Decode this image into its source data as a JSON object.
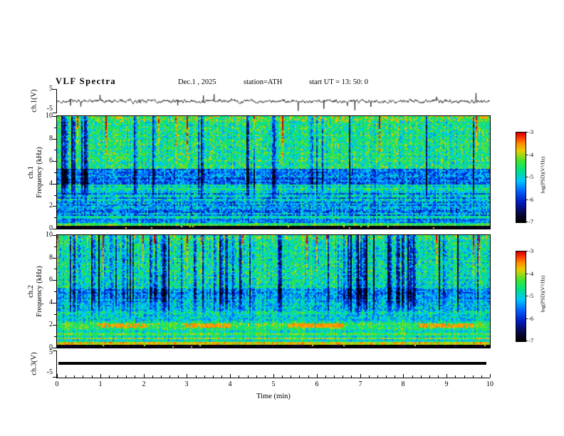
{
  "header": {
    "title": "VLF  Spectra",
    "date": "Dec.1  , 2025",
    "station": "station=ATH",
    "start_ut": "start UT =   13: 50: 0"
  },
  "xaxis": {
    "label": "Time  (min)",
    "range": [
      0,
      10
    ],
    "ticks": [
      "0",
      "1",
      "2",
      "3",
      "4",
      "5",
      "6",
      "7",
      "8",
      "9",
      "10"
    ]
  },
  "colorbar": {
    "label": "log(PSD)(V²/Hz)",
    "range": [
      -7,
      -3
    ],
    "ticks": [
      "-3",
      "-4",
      "-5",
      "-6",
      "-7"
    ]
  },
  "panels": {
    "wave1": {
      "ylabel": "ch.1(V)",
      "yticks": [
        "5",
        "-5"
      ]
    },
    "spec1": {
      "line1": "ch.1",
      "line2": "Frequency (kHz)"
    },
    "spec2": {
      "line1": "ch.2",
      "line2": "Frequency (kHz)"
    },
    "wave3": {
      "ylabel": "ch.3(V)",
      "yticks": [
        "5",
        "-5"
      ]
    }
  },
  "chart_data": [
    {
      "id": "ch1-waveform",
      "type": "line",
      "ylabel": "ch.1(V)",
      "ylim": [
        -5,
        5
      ],
      "xlim": [
        0,
        10
      ],
      "yticks": [
        "5",
        "-5"
      ],
      "description": "Broadband VLF voltage waveform fluctuating around 0 V with impulsive sferic spikes up to about ±4 V over 10 minutes",
      "gen": {
        "seed": 7,
        "n": 1216,
        "ar": 0.72,
        "sigma": 0.34,
        "spike_prob": 0.013,
        "spike_min": 1.2,
        "spike_max": 4.4,
        "neg_bias": 0.55
      }
    },
    {
      "id": "ch1-spectrogram",
      "type": "heatmap",
      "ylabel": "ch.1 Frequency (kHz)",
      "ylim": [
        0,
        10
      ],
      "xlim": [
        0,
        10
      ],
      "yticks_major": [
        10,
        8,
        6,
        4,
        2,
        0
      ],
      "zlabel": "log(PSD)(V²/Hz)",
      "zlim": [
        -7,
        -3
      ],
      "description": "Spectrogram of ch.1: green/cyan background with dense dark-blue vertical sferic streaks, dark band near 4-5 kHz, black band below 0.3 kHz, bright line near 0.4 kHz, red flecks at top",
      "gen": {
        "seed": 21,
        "bands": [
          {
            "f": [
              0,
              0.3
            ],
            "v": -6.9,
            "noise": 0.2,
            "stripe": 0.2
          },
          {
            "f": [
              0.3,
              0.55
            ],
            "v": -4.45,
            "noise": 0.5,
            "stripe": 0.8
          },
          {
            "f": [
              0.55,
              0.9
            ],
            "v": -5.5,
            "noise": 0.6,
            "stripe": 1.2
          },
          {
            "f": [
              0.9,
              1.15
            ],
            "v": -4.75,
            "noise": 0.6,
            "stripe": 1.0
          },
          {
            "f": [
              1.15,
              3.2
            ],
            "v": -5.3,
            "noise": 0.8,
            "stripe": 1.7
          },
          {
            "f": [
              3.2,
              3.9
            ],
            "v": -4.85,
            "noise": 0.7,
            "stripe": 1.0
          },
          {
            "f": [
              3.9,
              5.3
            ],
            "v": -5.7,
            "noise": 0.7,
            "stripe": 1.3
          },
          {
            "f": [
              5.3,
              9.5
            ],
            "v": -4.65,
            "noise": 0.8,
            "stripe": 0.5
          },
          {
            "f": [
              9.5,
              10
            ],
            "v": -4.4,
            "noise": 0.9,
            "stripe": 0.4
          }
        ],
        "streak": {
          "prob": 0.16,
          "min": 0.7,
          "max": 1.9,
          "fmin": 2.2,
          "ramp": 1.6
        },
        "bright": {
          "prob": 0.05,
          "boost": 1.0,
          "fmin": 5.0,
          "top_f": 8.8,
          "top_extra": 0.9
        },
        "red_dots": {
          "prob": 0.012,
          "f": [
            0,
            0.3
          ],
          "v": -3.8
        }
      }
    },
    {
      "id": "ch2-spectrogram",
      "type": "heatmap",
      "ylabel": "ch.2 Frequency (kHz)",
      "ylim": [
        0,
        10
      ],
      "xlim": [
        0,
        10
      ],
      "yticks_major": [
        10,
        8,
        6,
        4,
        2,
        0
      ],
      "zlabel": "log(PSD)(V²/Hz)",
      "zlim": [
        -7,
        -3
      ],
      "description": "Spectrogram of ch.2: green background with dark-blue vertical streaks above 5 kHz, orange horizontal power-line harmonics near 0.35/0.8/1.1 kHz, dashed orange segments near 2 kHz, black band below 0.28 kHz",
      "gen": {
        "seed": 33,
        "bands": [
          {
            "f": [
              0,
              0.28
            ],
            "v": -6.9,
            "noise": 0.2,
            "stripe": 0.2
          },
          {
            "f": [
              0.28,
              0.45
            ],
            "v": -3.75,
            "noise": 0.4,
            "stripe": 0.5
          },
          {
            "f": [
              0.45,
              0.7
            ],
            "v": -4.95,
            "noise": 0.5,
            "stripe": 0.9
          },
          {
            "f": [
              0.7,
              0.88
            ],
            "v": -4.0,
            "noise": 0.45,
            "stripe": 0.6
          },
          {
            "f": [
              0.88,
              1.08
            ],
            "v": -4.85,
            "noise": 0.5,
            "stripe": 0.8
          },
          {
            "f": [
              1.08,
              1.25
            ],
            "v": -4.15,
            "noise": 0.5,
            "stripe": 0.6
          },
          {
            "f": [
              1.25,
              1.8
            ],
            "v": -4.7,
            "noise": 0.6,
            "stripe": 0.9
          },
          {
            "f": [
              1.8,
              2.15
            ],
            "v": -4.35,
            "noise": 0.6,
            "stripe": 0.8
          },
          {
            "f": [
              2.15,
              3.6
            ],
            "v": -4.9,
            "noise": 0.7,
            "stripe": 1.2
          },
          {
            "f": [
              3.6,
              4.3
            ],
            "v": -5.2,
            "noise": 0.7,
            "stripe": 1.1
          },
          {
            "f": [
              4.3,
              5.3
            ],
            "v": -5.4,
            "noise": 0.7,
            "stripe": 1.1
          },
          {
            "f": [
              5.3,
              9.5
            ],
            "v": -4.8,
            "noise": 0.8,
            "stripe": 0.5
          },
          {
            "f": [
              9.5,
              10
            ],
            "v": -4.55,
            "noise": 0.9,
            "stripe": 0.4
          }
        ],
        "streak": {
          "prob": 0.17,
          "min": 0.7,
          "max": 2.0,
          "fmin": 2.6,
          "ramp": 1.8
        },
        "bright": {
          "prob": 0.04,
          "boost": 0.9,
          "fmin": 5.5,
          "top_f": 9.3,
          "top_extra": 0.8
        },
        "red_dots": {
          "prob": 0.02,
          "f": [
            0,
            0.28
          ],
          "v": -3.9
        },
        "orange_segments": {
          "t": [
            [
              0.9,
              2.05
            ],
            [
              2.95,
              4.0
            ],
            [
              5.3,
              6.6
            ],
            [
              8.35,
              9.6
            ]
          ],
          "f": [
            1.82,
            2.12
          ],
          "v": -3.55
        }
      }
    },
    {
      "id": "ch3-waveform",
      "type": "line",
      "ylabel": "ch.3(V)",
      "ylim": [
        -5,
        5
      ],
      "xlim": [
        0,
        10
      ],
      "yticks": [
        "5",
        "-5"
      ],
      "value": 0,
      "description": "Flat thick black trace at 0 V (channel 3 inactive)"
    }
  ]
}
